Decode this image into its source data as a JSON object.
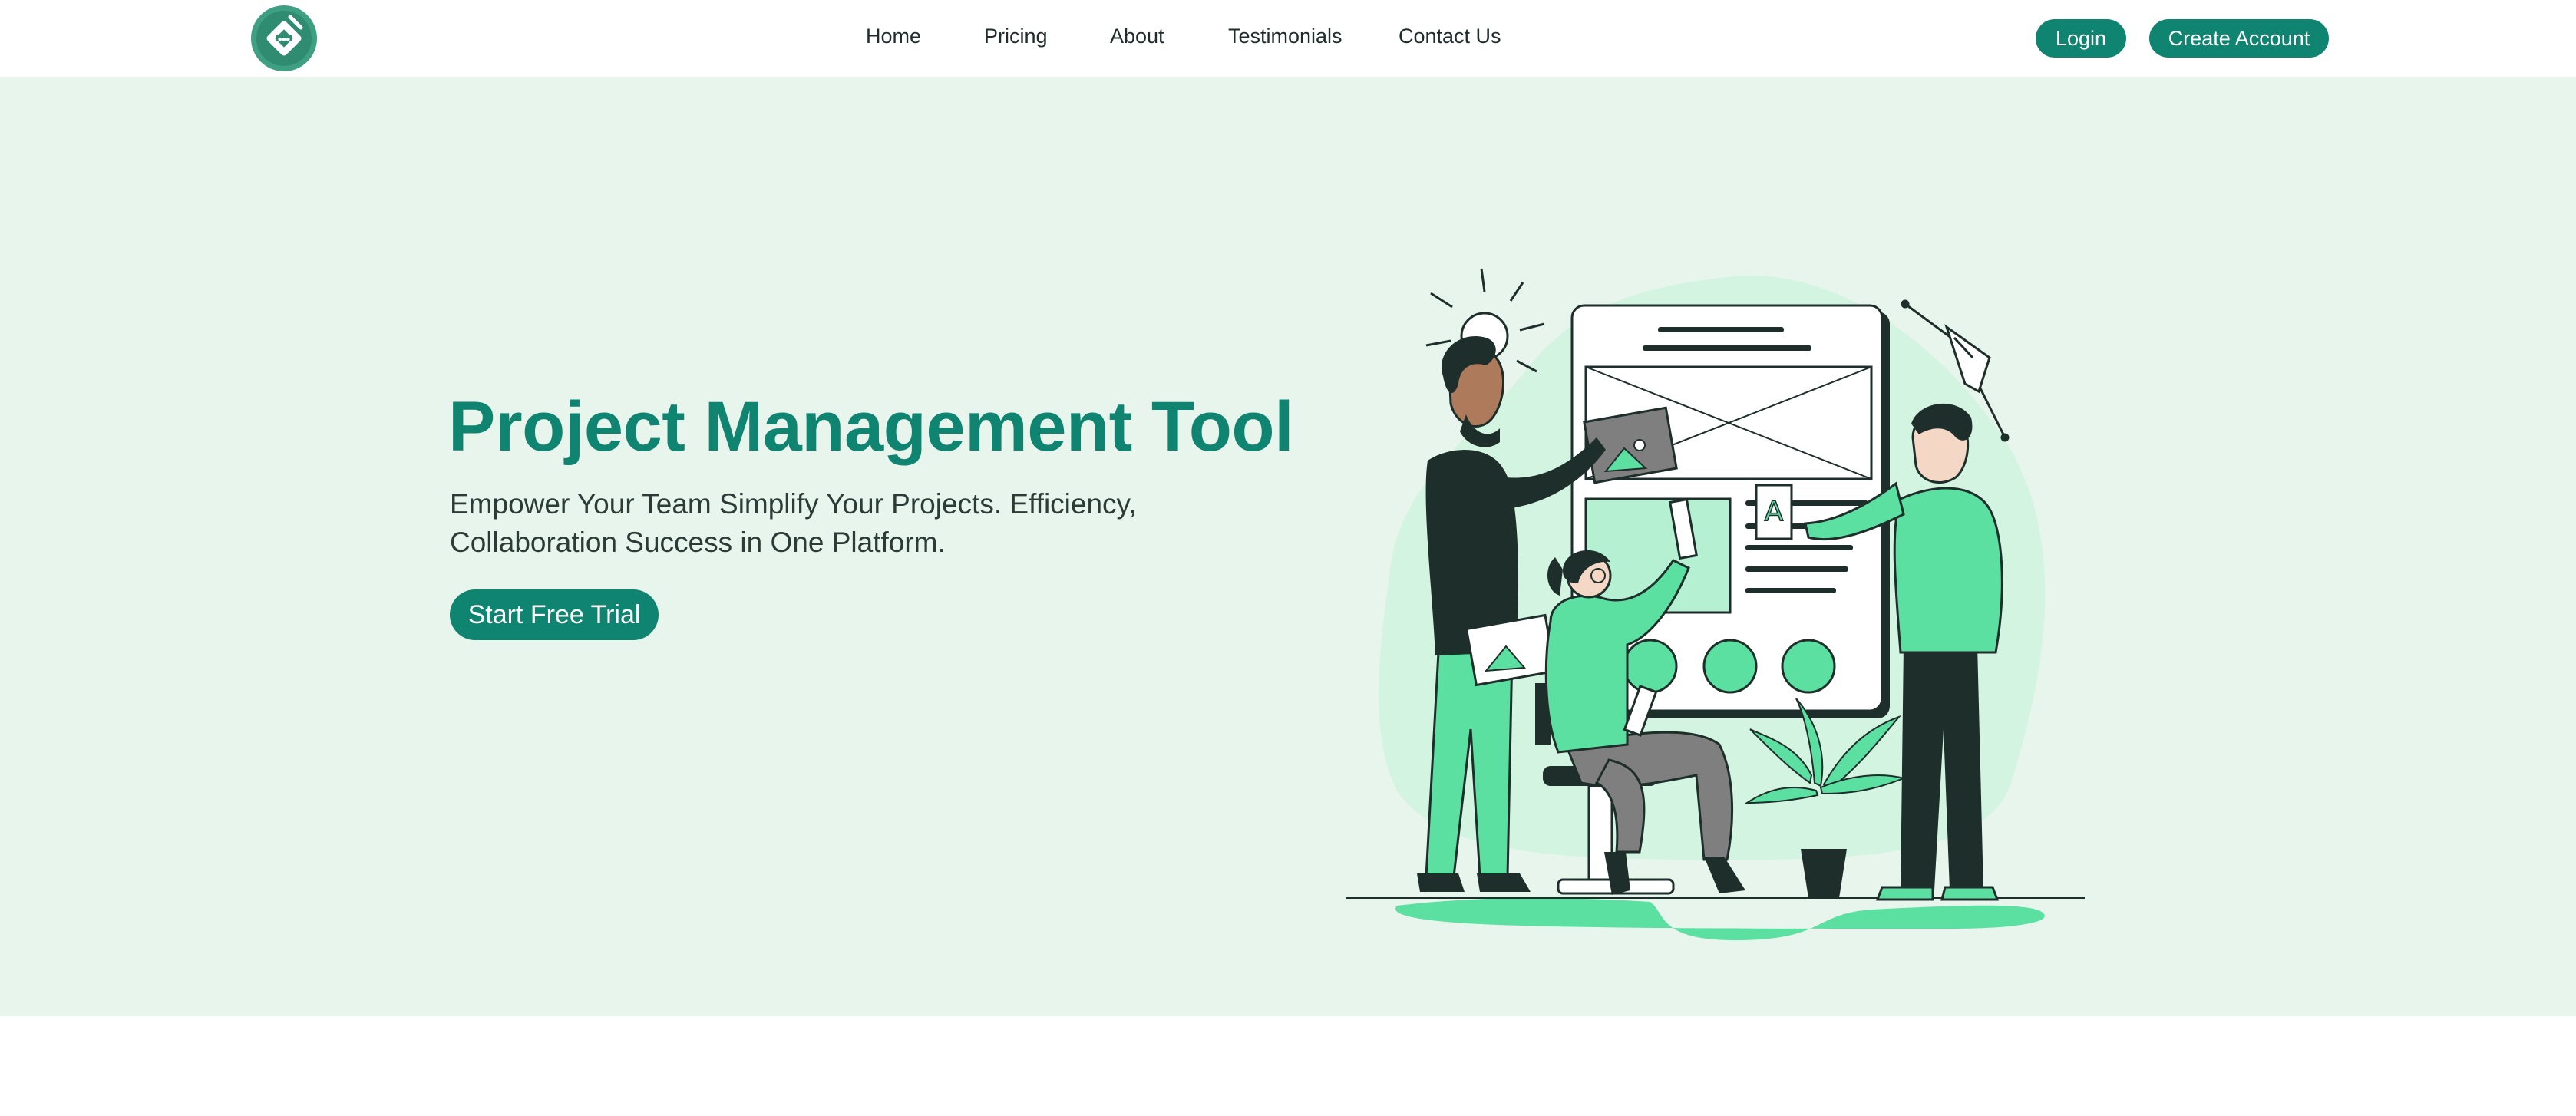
{
  "nav": {
    "links": [
      "Home",
      "Pricing",
      "About",
      "Testimonials",
      "Contact Us"
    ],
    "login_label": "Login",
    "create_account_label": "Create Account"
  },
  "hero": {
    "title": "Project Management Tool",
    "subtitle": "Empower Your Team Simplify Your Projects. Efficiency, Collaboration Success in One Platform.",
    "cta_label": "Start Free Trial"
  },
  "colors": {
    "primary": "#0f8470",
    "hero_bg": "#e7f5ec",
    "accent_green": "#5ce0a2",
    "dark": "#1e2e2b"
  },
  "icons": {
    "logo": "brand-logo-icon",
    "illustration": "team-collaboration-illustration"
  }
}
